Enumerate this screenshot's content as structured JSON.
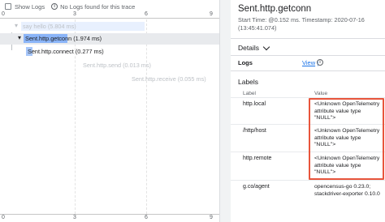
{
  "toolbar": {
    "show_logs_label": "Show Logs",
    "info_icon": "info-icon",
    "no_logs_text": "No Logs found for this trace"
  },
  "axis": {
    "ticks": [
      "0",
      "3",
      "6",
      "9"
    ]
  },
  "spans": [
    {
      "label": "say hello (5.804 ms)"
    },
    {
      "label": "Sent.http.getconn (1.974 ms)"
    },
    {
      "label": "Sent.http.connect (0.277 ms)"
    },
    {
      "label": "Sent.http.send (0.013 ms)"
    },
    {
      "label": "Sent.http.receive (0.055 ms)"
    }
  ],
  "details": {
    "title": "Sent.http.getconn",
    "meta": "Start Time: @0.152 ms. Timestamp: 2020-07-16 (13:45:41.074)",
    "section_label": "Details",
    "logs_label": "Logs",
    "logs_link_main": "View",
    "logs_link_suffix": " |",
    "labels_heading": "Labels",
    "table_header": {
      "label": "Label",
      "value": "Value"
    },
    "rows": [
      {
        "key": "http.local",
        "value": "<Unknown OpenTelemetry attribute value type \"NULL\">"
      },
      {
        "key": "/http/host",
        "value": "<Unknown OpenTelemetry attribute value type \"NULL\">"
      },
      {
        "key": "http.remote",
        "value": "<Unknown OpenTelemetry attribute value type \"NULL\">"
      },
      {
        "key": "g.co/agent",
        "value": "opencensus-go 0.23.0; stackdriver-exporter 0.10.0"
      }
    ]
  },
  "colors": {
    "accent": "#1a73e8",
    "bar": "#8ab4f8",
    "highlight": "#e8553c"
  }
}
